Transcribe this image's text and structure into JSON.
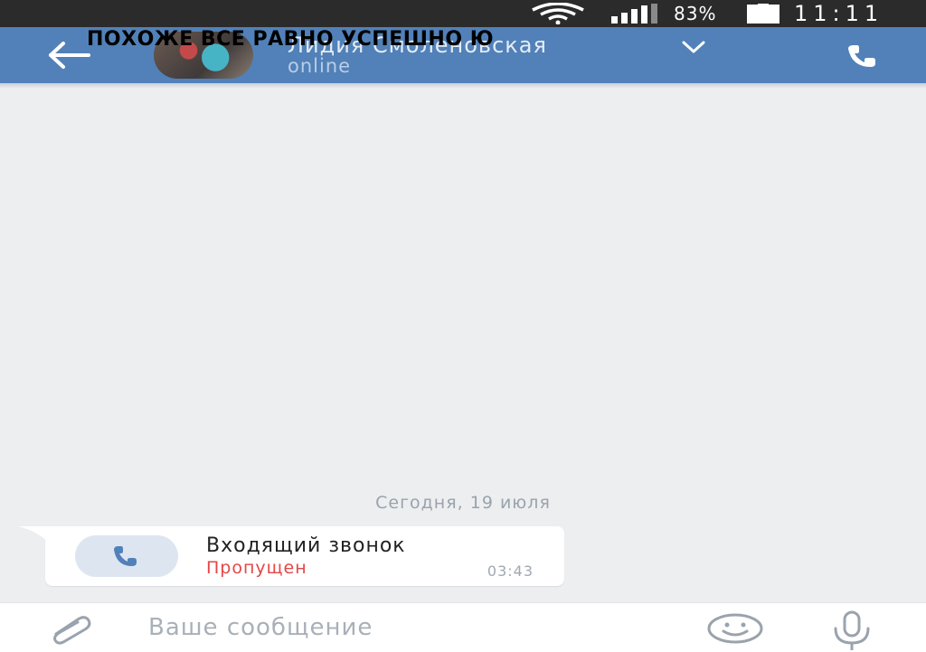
{
  "status_bar": {
    "battery_percent": "83%",
    "time": "11:11",
    "icons": [
      "wifi-icon",
      "signal-icon",
      "battery-icon"
    ]
  },
  "header": {
    "contact_name": "Лидия Смоленовская",
    "contact_status": "online",
    "overlay_caption": "ПОХОЖЕ ВСЕ РАВНО УСПЕШНО Ю",
    "icons": [
      "back-arrow-icon",
      "chevron-down-icon",
      "phone-icon"
    ]
  },
  "conversation": {
    "date_divider": "Сегодня, 19 июля",
    "call_message": {
      "title": "Входящий звонок",
      "status": "Пропущен",
      "time": "03:43",
      "icon": "phone-icon"
    }
  },
  "composer": {
    "placeholder": "Ваше сообщение",
    "value": "",
    "icons": [
      "paperclip-icon",
      "smile-icon",
      "microphone-icon"
    ]
  },
  "colors": {
    "header_bg": "#5181b8",
    "background": "#edeef0",
    "missed": "#e64646",
    "status_bar_bg": "#2b2b2b"
  }
}
